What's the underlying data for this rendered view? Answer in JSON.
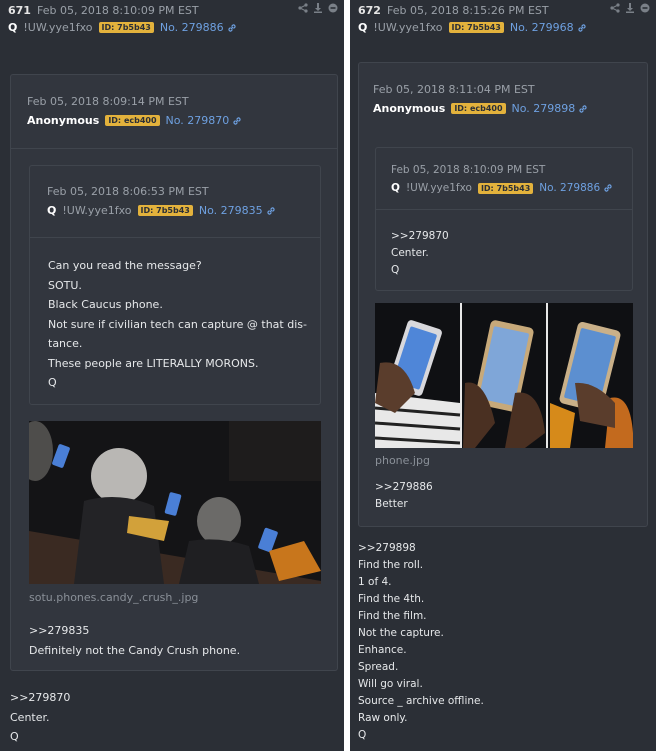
{
  "left": {
    "post": {
      "number": "671",
      "date": "Feb 05, 2018 8:10:09 PM EST",
      "name": "Q",
      "trip": "!UW.yye1fxo",
      "id_label": "ID:",
      "id": "7b5b43",
      "postno": "No. 279886"
    },
    "quote1": {
      "date": "Feb 05, 2018 8:09:14 PM EST",
      "name": "Anonymous",
      "id_label": "ID:",
      "id": "ecb400",
      "postno": "No. 279870",
      "image_filename": "sotu.phones.candy_.crush_.jpg",
      "lines": [
        ">>279835",
        "Definitely not the Candy Crush phone."
      ]
    },
    "quote2": {
      "date": "Feb 05, 2018 8:06:53 PM EST",
      "name": "Q",
      "trip": "!UW.yye1fxo",
      "id_label": "ID:",
      "id": "7b5b43",
      "postno": "No. 279835",
      "lines": [
        "Can you read the message?",
        "SOTU.",
        "Black Caucus phone.",
        "Not sure if civilian tech can capture @ that dis-",
        "tance.",
        "These people are LITERALLY MORONS.",
        "Q"
      ]
    },
    "footer_lines": [
      ">>279870",
      "Center.",
      "Q"
    ]
  },
  "right": {
    "post": {
      "number": "672",
      "date": "Feb 05, 2018 8:15:26 PM EST",
      "name": "Q",
      "trip": "!UW.yye1fxo",
      "id_label": "ID:",
      "id": "7b5b43",
      "postno": "No. 279968"
    },
    "quote1": {
      "date": "Feb 05, 2018 8:11:04 PM EST",
      "name": "Anonymous",
      "id_label": "ID:",
      "id": "ecb400",
      "postno": "No. 279898",
      "image_filename": "phone.jpg",
      "lines": [
        ">>279886",
        "Better"
      ]
    },
    "quote2": {
      "date": "Feb 05, 2018 8:10:09 PM EST",
      "name": "Q",
      "trip": "!UW.yye1fxo",
      "id_label": "ID:",
      "id": "7b5b43",
      "postno": "No. 279886",
      "lines": [
        ">>279870",
        "Center.",
        "Q"
      ]
    },
    "footer_lines": [
      ">>279898",
      "Find the roll.",
      "1 of 4.",
      "Find the 4th.",
      "Find the film.",
      "Not the capture.",
      "Enhance.",
      "Spread.",
      "Will go viral.",
      "Source _ archive offline.",
      "Raw only.",
      "Q"
    ]
  },
  "icons": [
    "share-icon",
    "download-icon",
    "hide-icon",
    "link-icon"
  ],
  "colors": {
    "background": "#2b2f36",
    "card": "#32363e",
    "id_badge": "#e3b23c",
    "link": "#6ea0e0"
  }
}
